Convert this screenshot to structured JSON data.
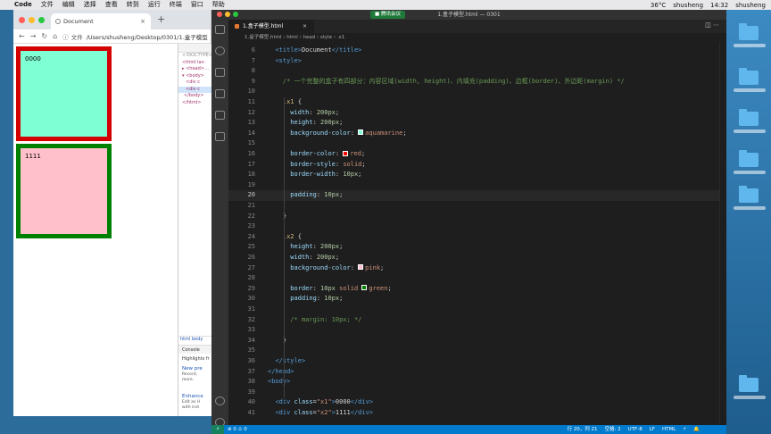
{
  "menubar": {
    "apple": "",
    "items": [
      "Code",
      "文件",
      "编辑",
      "选择",
      "查看",
      "转到",
      "运行",
      "终端",
      "窗口",
      "帮助"
    ],
    "right": [
      "36°C",
      "shusheng",
      "14:32",
      "shusheng"
    ]
  },
  "browser": {
    "tab_title": "Document",
    "tab_close": "×",
    "new_tab": "+",
    "address_label": "文件",
    "url": "/Users/shusheng/Desktop/0301/1.盒子模型",
    "box1_text": "0000",
    "box2_text": "1111",
    "devtools": {
      "lines": [
        "<!DOCTYPE>",
        "<html lan",
        "▸ <head>…",
        "▾ <body>",
        "<div c",
        "<div c",
        "</body>",
        "</html>"
      ],
      "crumbs": [
        "html",
        "body"
      ],
      "console_label": "Console",
      "highlights": "Highlights fr",
      "notes": [
        {
          "title": "New pre",
          "lines": [
            "Record,",
            "more."
          ]
        },
        {
          "title": "Enhance",
          "lines": [
            "Edit as H",
            "with inst"
          ]
        }
      ]
    }
  },
  "vscode": {
    "window_title": "1.盒子模型.html — 0301",
    "meeting_badge": "■ 腾讯会议",
    "tab_label": "1.盒子模型.html",
    "tab_close": "×",
    "breadcrumb": [
      "1.盒子模型.html",
      "html",
      "head",
      "style",
      ".x1"
    ],
    "code_lines": [
      {
        "n": "6",
        "indent": 1,
        "tokens": [
          [
            "tag",
            "<title>"
          ],
          [
            "plain",
            "Document"
          ],
          [
            "tag",
            "</title>"
          ]
        ]
      },
      {
        "n": "7",
        "indent": 1,
        "tokens": [
          [
            "tag",
            "<style>"
          ]
        ]
      },
      {
        "n": "8",
        "indent": 0,
        "tokens": []
      },
      {
        "n": "9",
        "indent": 2,
        "tokens": [
          [
            "com",
            "/* 一个完整的盒子有四部分：内容区域(width, height)、内填充(padding)、边框(border)、外边距(margin) */"
          ]
        ]
      },
      {
        "n": "10",
        "indent": 0,
        "tokens": []
      },
      {
        "n": "11",
        "indent": 2,
        "tokens": [
          [
            "sel",
            ".x1"
          ],
          [
            "plain",
            " {"
          ]
        ]
      },
      {
        "n": "12",
        "indent": 3,
        "tokens": [
          [
            "prop",
            "width"
          ],
          [
            "plain",
            ": "
          ],
          [
            "num",
            "200px"
          ],
          [
            "plain",
            ";"
          ]
        ]
      },
      {
        "n": "13",
        "indent": 3,
        "tokens": [
          [
            "prop",
            "height"
          ],
          [
            "plain",
            ": "
          ],
          [
            "num",
            "200px"
          ],
          [
            "plain",
            ";"
          ]
        ]
      },
      {
        "n": "14",
        "indent": 3,
        "tokens": [
          [
            "prop",
            "background-color"
          ],
          [
            "plain",
            ": "
          ],
          [
            "swatch",
            "aquamarine"
          ],
          [
            "val",
            "aquamarine"
          ],
          [
            "plain",
            ";"
          ]
        ]
      },
      {
        "n": "15",
        "indent": 0,
        "tokens": []
      },
      {
        "n": "16",
        "indent": 3,
        "tokens": [
          [
            "prop",
            "border-color"
          ],
          [
            "plain",
            ": "
          ],
          [
            "swatch",
            "red"
          ],
          [
            "val",
            "red"
          ],
          [
            "plain",
            ";"
          ]
        ]
      },
      {
        "n": "17",
        "indent": 3,
        "tokens": [
          [
            "prop",
            "border-style"
          ],
          [
            "plain",
            ": "
          ],
          [
            "val",
            "solid"
          ],
          [
            "plain",
            ";"
          ]
        ]
      },
      {
        "n": "18",
        "indent": 3,
        "tokens": [
          [
            "prop",
            "border-width"
          ],
          [
            "plain",
            ": "
          ],
          [
            "num",
            "10px"
          ],
          [
            "plain",
            ";"
          ]
        ]
      },
      {
        "n": "19",
        "indent": 0,
        "tokens": []
      },
      {
        "n": "20",
        "indent": 3,
        "cur": true,
        "tokens": [
          [
            "prop",
            "padding"
          ],
          [
            "plain",
            ": "
          ],
          [
            "num",
            "10px"
          ],
          [
            "plain",
            ";"
          ]
        ]
      },
      {
        "n": "21",
        "indent": 0,
        "tokens": []
      },
      {
        "n": "22",
        "indent": 2,
        "tokens": [
          [
            "plain",
            "}"
          ]
        ]
      },
      {
        "n": "23",
        "indent": 0,
        "tokens": []
      },
      {
        "n": "24",
        "indent": 2,
        "tokens": [
          [
            "sel",
            ".x2"
          ],
          [
            "plain",
            " {"
          ]
        ]
      },
      {
        "n": "25",
        "indent": 3,
        "tokens": [
          [
            "prop",
            "height"
          ],
          [
            "plain",
            ": "
          ],
          [
            "num",
            "200px"
          ],
          [
            "plain",
            ";"
          ]
        ]
      },
      {
        "n": "26",
        "indent": 3,
        "tokens": [
          [
            "prop",
            "width"
          ],
          [
            "plain",
            ": "
          ],
          [
            "num",
            "200px"
          ],
          [
            "plain",
            ";"
          ]
        ]
      },
      {
        "n": "27",
        "indent": 3,
        "tokens": [
          [
            "prop",
            "background-color"
          ],
          [
            "plain",
            ": "
          ],
          [
            "swatch",
            "pink"
          ],
          [
            "val",
            "pink"
          ],
          [
            "plain",
            ";"
          ]
        ]
      },
      {
        "n": "28",
        "indent": 0,
        "tokens": []
      },
      {
        "n": "29",
        "indent": 3,
        "tokens": [
          [
            "prop",
            "border"
          ],
          [
            "plain",
            ": "
          ],
          [
            "num",
            "10px"
          ],
          [
            "val",
            " solid "
          ],
          [
            "swatch",
            "green"
          ],
          [
            "val",
            "green"
          ],
          [
            "plain",
            ";"
          ]
        ]
      },
      {
        "n": "30",
        "indent": 3,
        "tokens": [
          [
            "prop",
            "padding"
          ],
          [
            "plain",
            ": "
          ],
          [
            "num",
            "10px"
          ],
          [
            "plain",
            ";"
          ]
        ]
      },
      {
        "n": "31",
        "indent": 0,
        "tokens": []
      },
      {
        "n": "32",
        "indent": 3,
        "tokens": [
          [
            "com",
            "/* margin: 10px; */"
          ]
        ]
      },
      {
        "n": "33",
        "indent": 0,
        "tokens": []
      },
      {
        "n": "34",
        "indent": 2,
        "tokens": [
          [
            "plain",
            "}"
          ]
        ]
      },
      {
        "n": "35",
        "indent": 0,
        "tokens": []
      },
      {
        "n": "36",
        "indent": 1,
        "tokens": [
          [
            "tag",
            "</style>"
          ]
        ]
      },
      {
        "n": "37",
        "indent": 0,
        "tokens": [
          [
            "tag",
            "</head>"
          ]
        ]
      },
      {
        "n": "38",
        "indent": 0,
        "tokens": [
          [
            "tag",
            "<body>"
          ]
        ]
      },
      {
        "n": "39",
        "indent": 0,
        "tokens": []
      },
      {
        "n": "40",
        "indent": 1,
        "tokens": [
          [
            "tag",
            "<div "
          ],
          [
            "attr",
            "class"
          ],
          [
            "plain",
            "="
          ],
          [
            "str",
            "\"x1\""
          ],
          [
            "tag",
            ">"
          ],
          [
            "plain",
            "0000"
          ],
          [
            "tag",
            "</div>"
          ]
        ]
      },
      {
        "n": "41",
        "indent": 1,
        "tokens": [
          [
            "tag",
            "<div "
          ],
          [
            "attr",
            "class"
          ],
          [
            "plain",
            "="
          ],
          [
            "str",
            "\"x2\""
          ],
          [
            "tag",
            ">"
          ],
          [
            "plain",
            "1111"
          ],
          [
            "tag",
            "</div>"
          ]
        ]
      }
    ],
    "status": {
      "remote": "⚡",
      "problems": "⊗ 0  ⚠ 0",
      "right": [
        "行 20，列 21",
        "空格: 2",
        "UTF-8",
        "LF",
        "HTML",
        "⚡",
        "🔔"
      ]
    }
  },
  "colors": {
    "vscode_bg": "#1e1e1e",
    "status_blue": "#007acc",
    "box1_border": "#d40000",
    "box2_border": "#008000"
  }
}
